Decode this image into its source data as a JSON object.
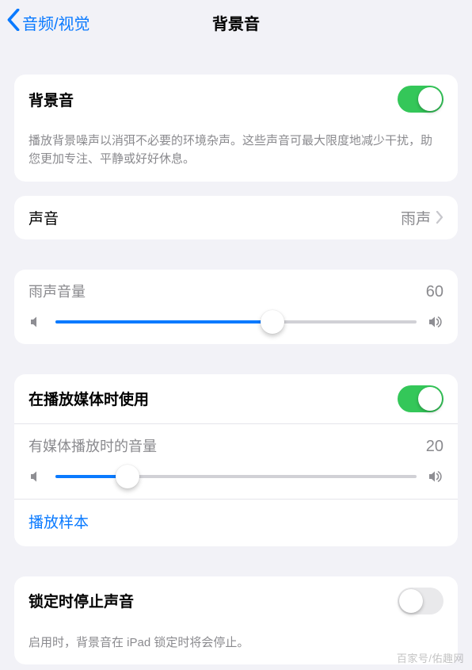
{
  "nav": {
    "back_label": "音频/视觉",
    "title": "背景音"
  },
  "bg_sound": {
    "label": "背景音",
    "enabled": true,
    "description": "播放背景噪声以消弭不必要的环境杂声。这些声音可最大限度地减少干扰，助您更加专注、平静或好好休息。"
  },
  "sound_select": {
    "label": "声音",
    "value": "雨声"
  },
  "volume": {
    "label": "雨声音量",
    "value": 60
  },
  "media": {
    "use_label": "在播放媒体时使用",
    "enabled": true,
    "vol_label": "有媒体播放时的音量",
    "vol_value": 20,
    "sample_label": "播放样本"
  },
  "lock_stop": {
    "label": "锁定时停止声音",
    "enabled": false,
    "description": "启用时，背景音在 iPad 锁定时将会停止。"
  },
  "watermark": "百家号/佑趣网"
}
